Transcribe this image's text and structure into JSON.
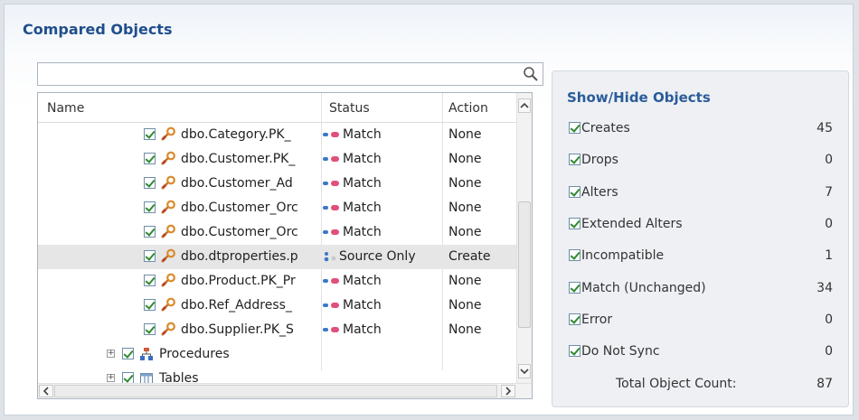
{
  "panel": {
    "title": "Compared Objects"
  },
  "search": {
    "placeholder": "",
    "value": ""
  },
  "tree": {
    "columns": {
      "name": "Name",
      "status": "Status",
      "action": "Action"
    },
    "rows": [
      {
        "name": "dbo.Category.PK_",
        "status": "Match",
        "action": "None",
        "selected": false
      },
      {
        "name": "dbo.Customer.PK_",
        "status": "Match",
        "action": "None",
        "selected": false
      },
      {
        "name": "dbo.Customer_Ad",
        "status": "Match",
        "action": "None",
        "selected": false
      },
      {
        "name": "dbo.Customer_Orc",
        "status": "Match",
        "action": "None",
        "selected": false
      },
      {
        "name": "dbo.Customer_Orc",
        "status": "Match",
        "action": "None",
        "selected": false
      },
      {
        "name": "dbo.dtproperties.p",
        "status": "Source Only",
        "action": "Create",
        "selected": true
      },
      {
        "name": "dbo.Product.PK_Pr",
        "status": "Match",
        "action": "None",
        "selected": false
      },
      {
        "name": "dbo.Ref_Address_",
        "status": "Match",
        "action": "None",
        "selected": false
      },
      {
        "name": "dbo.Supplier.PK_S",
        "status": "Match",
        "action": "None",
        "selected": false
      }
    ],
    "groups": [
      {
        "label": "Procedures",
        "icon": "procedures-icon"
      },
      {
        "label": "Tables",
        "icon": "table-icon"
      }
    ]
  },
  "filters": {
    "title": "Show/Hide Objects",
    "items": [
      {
        "label": "Creates",
        "count": "45",
        "checked": true
      },
      {
        "label": "Drops",
        "count": "0",
        "checked": true
      },
      {
        "label": "Alters",
        "count": "7",
        "checked": true
      },
      {
        "label": "Extended Alters",
        "count": "0",
        "checked": true
      },
      {
        "label": "Incompatible",
        "count": "1",
        "checked": true
      },
      {
        "label": "Match (Unchanged)",
        "count": "34",
        "checked": true
      },
      {
        "label": "Error",
        "count": "0",
        "checked": true
      },
      {
        "label": "Do Not Sync",
        "count": "0",
        "checked": true
      }
    ],
    "total_label": "Total Object Count:",
    "total_value": "87"
  },
  "colors": {
    "title": "#1f4e8c",
    "side_title": "#2a5c9a",
    "check": "#2f8a2f"
  }
}
